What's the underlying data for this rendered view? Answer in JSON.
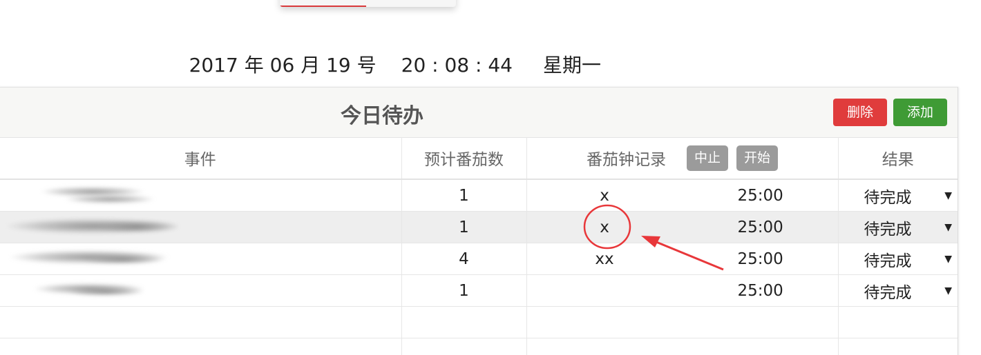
{
  "datetime": {
    "date": "2017 年 06 月 19 号",
    "time": "20 : 08 : 44",
    "weekday": "星期一"
  },
  "panel": {
    "title": "今日待办",
    "delete_label": "删除",
    "add_label": "添加"
  },
  "table": {
    "headers": {
      "event": "事件",
      "estimate": "预计番茄数",
      "record": "番茄钟记录",
      "result": "结果"
    },
    "record_buttons": {
      "stop": "中止",
      "start": "开始"
    },
    "rows": [
      {
        "event": "",
        "estimate": "1",
        "marks": "x",
        "timer": "25:00",
        "result": "待完成"
      },
      {
        "event": "",
        "estimate": "1",
        "marks": "x",
        "timer": "25:00",
        "result": "待完成"
      },
      {
        "event": "",
        "estimate": "4",
        "marks": "xx",
        "timer": "25:00",
        "result": "待完成"
      },
      {
        "event": "",
        "estimate": "1",
        "marks": "",
        "timer": "25:00",
        "result": "待完成"
      }
    ]
  },
  "icons": {
    "dropdown": "triangle-down-icon"
  },
  "colors": {
    "delete": "#e03c3c",
    "add": "#3f9b35",
    "mini_button": "#9b9b9b",
    "annotation": "#e8373a"
  }
}
